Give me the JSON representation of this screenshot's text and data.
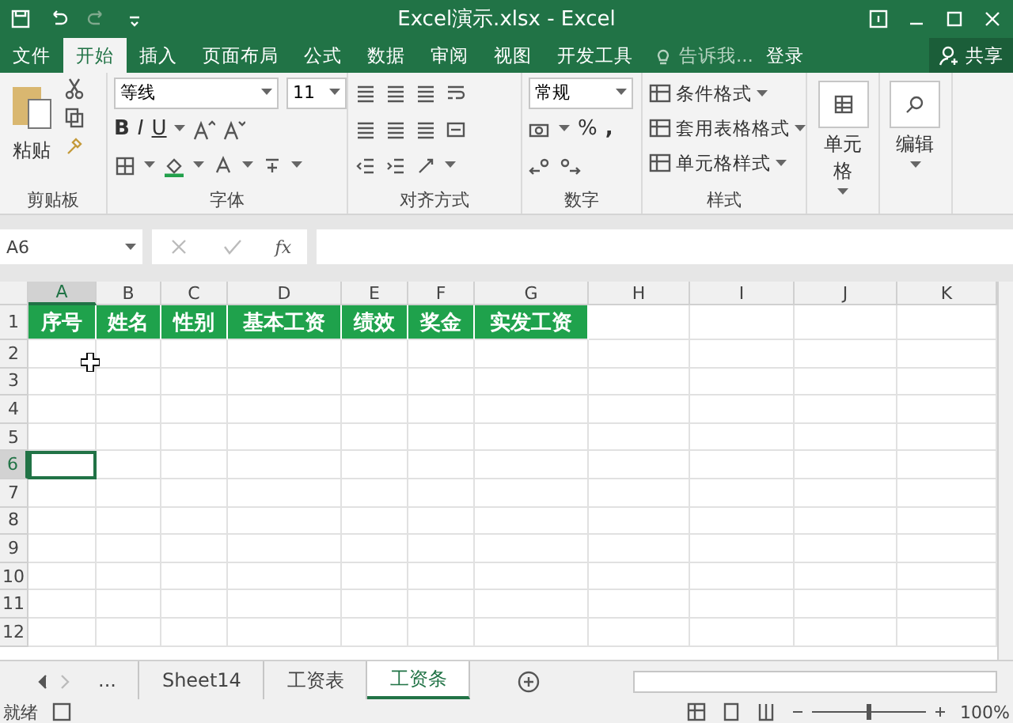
{
  "window": {
    "title": "Excel演示.xlsx - Excel"
  },
  "ribbon_tabs": [
    {
      "label": "文件",
      "selected": false
    },
    {
      "label": "开始",
      "selected": true
    },
    {
      "label": "插入",
      "selected": false
    },
    {
      "label": "页面布局",
      "selected": false
    },
    {
      "label": "公式",
      "selected": false
    },
    {
      "label": "数据",
      "selected": false
    },
    {
      "label": "审阅",
      "selected": false
    },
    {
      "label": "视图",
      "selected": false
    },
    {
      "label": "开发工具",
      "selected": false
    }
  ],
  "tell_me": {
    "placeholder": "告诉我..."
  },
  "login": "登录",
  "share": "共享",
  "ribbon": {
    "clipboard": {
      "paste": "粘贴",
      "label": "剪贴板"
    },
    "font": {
      "name": "等线",
      "size": "11",
      "bold": "B",
      "italic": "I",
      "underline": "U",
      "label": "字体"
    },
    "alignment": {
      "label": "对齐方式"
    },
    "number": {
      "format": "常规",
      "percent": "%",
      "comma": ",",
      "label": "数字"
    },
    "styles": {
      "items": [
        "条件格式",
        "套用表格格式",
        "单元格样式"
      ],
      "label": "样式"
    },
    "cells": {
      "label": "单元格"
    },
    "editing": {
      "label": "编辑"
    }
  },
  "formula_bar": {
    "name_box": "A6",
    "fx": "fx"
  },
  "columns": [
    {
      "label": "A",
      "selected": true
    },
    {
      "label": "B",
      "selected": false
    },
    {
      "label": "C",
      "selected": false
    },
    {
      "label": "D",
      "selected": false
    },
    {
      "label": "E",
      "selected": false
    },
    {
      "label": "F",
      "selected": false
    },
    {
      "label": "G",
      "selected": false
    },
    {
      "label": "H",
      "selected": false
    },
    {
      "label": "I",
      "selected": false
    },
    {
      "label": "J",
      "selected": false
    },
    {
      "label": "K",
      "selected": false
    }
  ],
  "rows": [
    {
      "label": "1",
      "selected": false,
      "cells": [
        "序号",
        "姓名",
        "性别",
        "基本工资",
        "绩效",
        "奖金",
        "实发工资"
      ]
    },
    {
      "label": "2",
      "selected": false
    },
    {
      "label": "3",
      "selected": false
    },
    {
      "label": "4",
      "selected": false
    },
    {
      "label": "5",
      "selected": false
    },
    {
      "label": "6",
      "selected": true
    },
    {
      "label": "7",
      "selected": false
    },
    {
      "label": "8",
      "selected": false
    },
    {
      "label": "9",
      "selected": false
    },
    {
      "label": "10",
      "selected": false
    },
    {
      "label": "11",
      "selected": false
    },
    {
      "label": "12",
      "selected": false
    }
  ],
  "sheet_tabs": {
    "more": "...",
    "tabs": [
      {
        "label": "Sheet14",
        "selected": false
      },
      {
        "label": "工资表",
        "selected": false
      },
      {
        "label": "工资条",
        "selected": true
      }
    ]
  },
  "status_bar": {
    "status": "就绪",
    "zoom_slider": {
      "level": 0.5
    },
    "zoom": "100%"
  }
}
